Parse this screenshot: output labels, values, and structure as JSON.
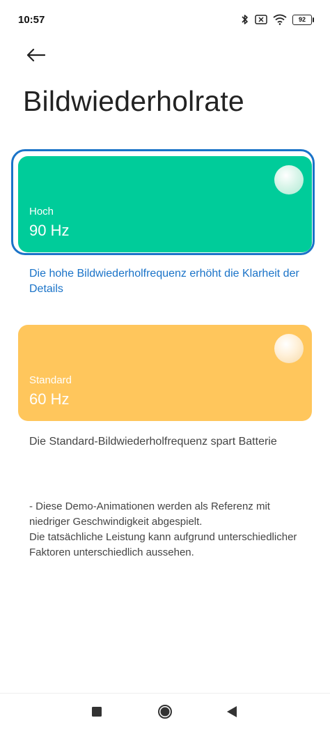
{
  "status_bar": {
    "time": "10:57",
    "battery": "92",
    "icons": [
      "bluetooth-icon",
      "sim-icon",
      "wifi-icon",
      "battery-icon"
    ]
  },
  "header": {
    "title": "Bildwiederholrate",
    "back_icon": "arrow-left-icon"
  },
  "options": [
    {
      "label": "Hoch",
      "value": "90 Hz",
      "description": "Die hohe Bildwiederholfrequenz erhöht die Klarheit der Details",
      "color": "#00cc9a",
      "selected": true
    },
    {
      "label": "Standard",
      "value": "60 Hz",
      "description": "Die Standard-Bildwiederholfrequenz spart Batterie",
      "color": "#ffc65c",
      "selected": false
    }
  ],
  "note": "- Diese Demo-Animationen werden als Referenz mit niedriger Geschwindigkeit abgespielt.\nDie tatsächliche Leistung kann aufgrund unterschiedlicher Faktoren unterschiedlich aussehen.",
  "colors": {
    "accent": "#1a73c8"
  },
  "nav_bar": {
    "icons": [
      "square-icon",
      "circle-home-icon",
      "triangle-back-icon"
    ]
  }
}
